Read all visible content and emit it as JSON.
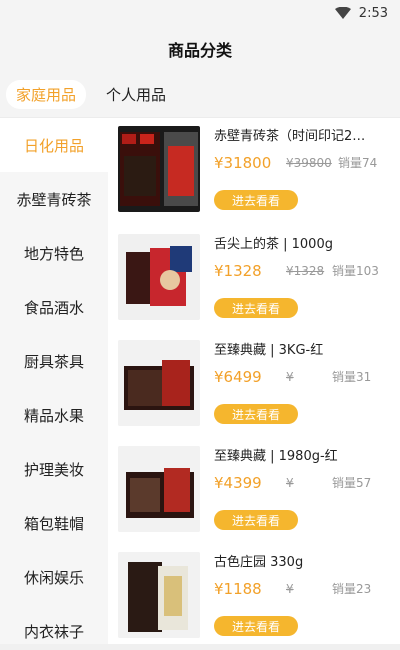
{
  "status": {
    "time": "2:53"
  },
  "header": {
    "title": "商品分类"
  },
  "tabs": [
    {
      "label": "家庭用品",
      "active": true
    },
    {
      "label": "个人用品",
      "active": false
    }
  ],
  "sidebar": {
    "items": [
      {
        "label": "日化用品",
        "active": true
      },
      {
        "label": "赤壁青砖茶",
        "active": false
      },
      {
        "label": "地方特色",
        "active": false
      },
      {
        "label": "食品酒水",
        "active": false
      },
      {
        "label": "厨具茶具",
        "active": false
      },
      {
        "label": "精品水果",
        "active": false
      },
      {
        "label": "护理美妆",
        "active": false
      },
      {
        "label": "箱包鞋帽",
        "active": false
      },
      {
        "label": "休闲娱乐",
        "active": false
      },
      {
        "label": "内衣袜子",
        "active": false
      }
    ]
  },
  "products": [
    {
      "title": "赤壁青砖茶（时间印记2…",
      "price": "¥31800",
      "old_price": "¥39800",
      "sales": "销量74",
      "button": "进去看看"
    },
    {
      "title": "舌尖上的茶 | 1000g",
      "price": "¥1328",
      "old_price": "¥1328",
      "sales": "销量103",
      "button": "进去看看"
    },
    {
      "title": "至臻典藏 | 3KG-红",
      "price": "¥6499",
      "old_price": "¥",
      "sales": "销量31",
      "button": "进去看看"
    },
    {
      "title": "至臻典藏 | 1980g-红",
      "price": "¥4399",
      "old_price": "¥",
      "sales": "销量57",
      "button": "进去看看"
    },
    {
      "title": "古色庄园 330g",
      "price": "¥1188",
      "old_price": "¥",
      "sales": "销量23",
      "button": "进去看看"
    }
  ],
  "colors": {
    "accent": "#f2a12a",
    "button": "#f5b62e"
  },
  "icons": {
    "wifi": "wifi-icon"
  }
}
